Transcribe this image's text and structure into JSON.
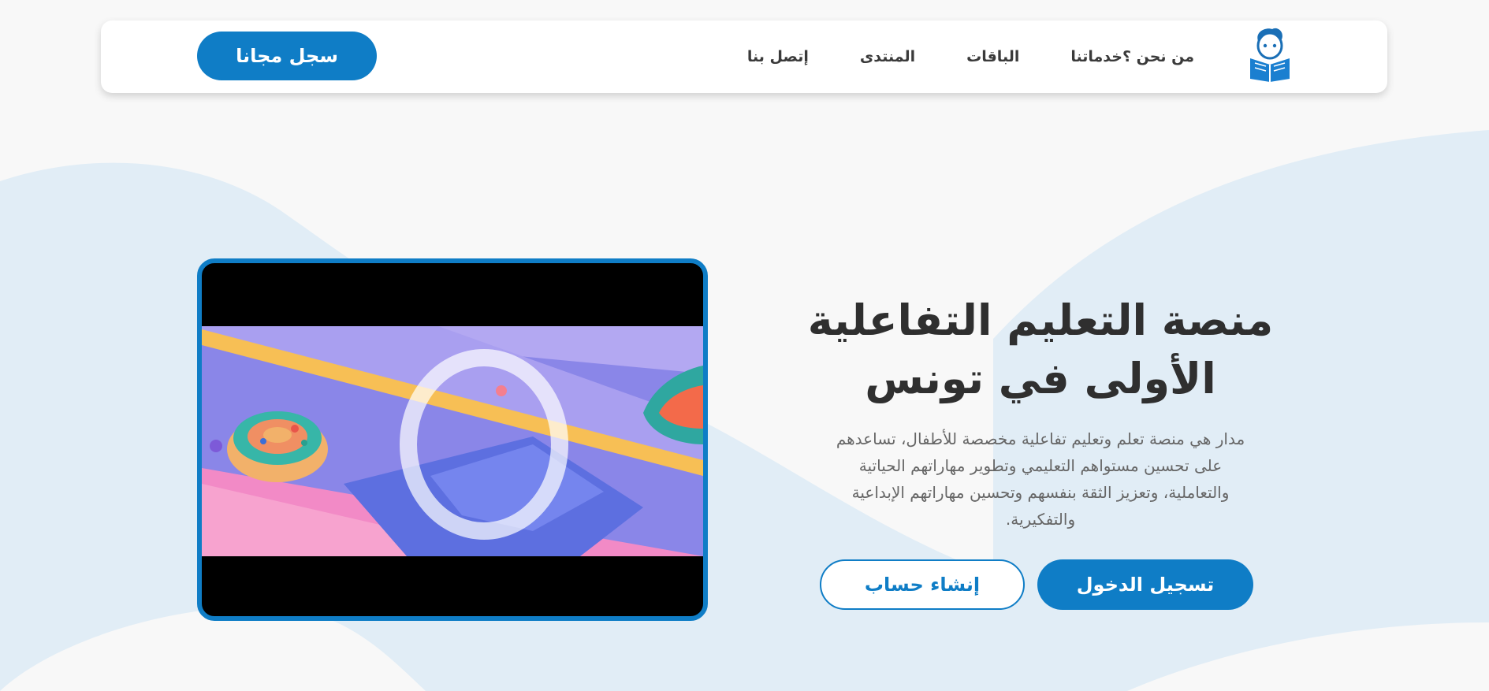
{
  "nav": {
    "logo_icon": "child-reading-book-icon",
    "links": [
      {
        "label": "من نحن ؟"
      },
      {
        "label": "خدماتنا"
      },
      {
        "label": "الباقات"
      },
      {
        "label": "المنتدى"
      },
      {
        "label": "إتصل بنا"
      }
    ],
    "signup_label": "سجل مجانا"
  },
  "hero": {
    "title_line1": "منصة التعليم التفاعلية",
    "title_line2": "الأولى في تونس",
    "description": "مدار هي منصة تعلم وتعليم تفاعلية مخصصة للأطفال، تساعدهم على تحسين مستواهم التعليمي وتطوير مهاراتهم الحياتية والتعاملية، وتعزيز الثقة بنفسهم وتحسين مهاراتهم الإبداعية والتفكيرية.",
    "login_label": "تسجيل الدخول",
    "create_account_label": "إنشاء حساب"
  },
  "colors": {
    "primary": "#0f7dc6",
    "wave": "#e1edf6",
    "background": "#f8f8f8"
  }
}
